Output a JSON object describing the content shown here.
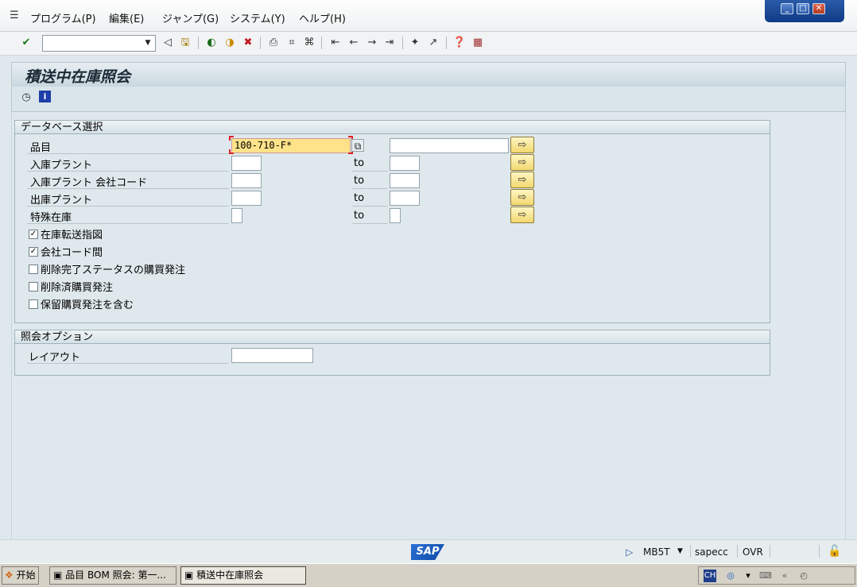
{
  "menubar": {
    "items": [
      "プログラム(P)",
      "編集(E)",
      "ジャンプ(G)",
      "システム(Y)",
      "ヘルプ(H)"
    ]
  },
  "title": "積送中在庫照会",
  "db_selection": {
    "header": "データベース選択",
    "rows": [
      {
        "label": "品目",
        "from_value": "100-710-F*"
      },
      {
        "label": "入庫プラント",
        "from_value": ""
      },
      {
        "label": "入庫プラント 会社コード",
        "from_value": ""
      },
      {
        "label": "出庫プラント",
        "from_value": ""
      },
      {
        "label": "特殊在庫",
        "from_value": ""
      }
    ],
    "to_label": "to",
    "checkboxes": [
      {
        "label": "在庫転送指図",
        "checked": true
      },
      {
        "label": "会社コード間",
        "checked": true
      },
      {
        "label": "削除完了ステータスの購買発注",
        "checked": false
      },
      {
        "label": "削除済購買発注",
        "checked": false
      },
      {
        "label": "保留購買発注を含む",
        "checked": false
      }
    ]
  },
  "options": {
    "header": "照会オプション",
    "layout_label": "レイアウト",
    "layout_value": ""
  },
  "statusbar": {
    "logo": "SAP",
    "tcode": "MB5T",
    "server": "sapecc",
    "mode": "OVR"
  },
  "taskbar": {
    "start": "开始",
    "tasks": [
      "品目 BOM 照会: 第一...",
      "積送中在庫照会"
    ]
  },
  "accent_colors": {
    "focus_field": "#ffe38a",
    "multi_button": "#f2d870",
    "window_controls": "#0e3b85"
  }
}
